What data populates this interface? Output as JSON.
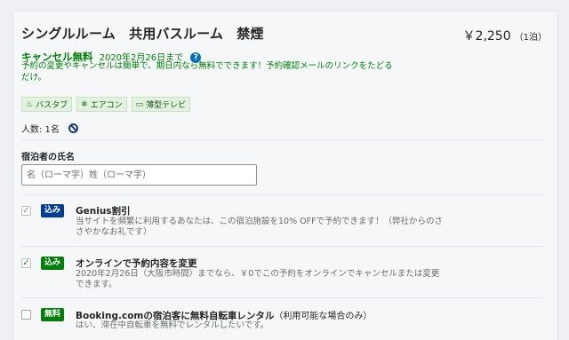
{
  "room": {
    "title": "シングルルーム　共用バスルーム　禁煙",
    "price": "￥2,250",
    "price_unit": "（1泊）"
  },
  "cancellation": {
    "headline": "キャンセル無料",
    "date": "2020年2月26日まで",
    "info_icon": "?",
    "description": "予約の変更やキャンセルは簡単で、期日内なら無料でできます！予約確認メールのリンクをたどるだけ。"
  },
  "facilities": [
    {
      "icon": "bath-icon",
      "glyph": "♨",
      "label": "バスタブ"
    },
    {
      "icon": "snowflake-icon",
      "glyph": "❄",
      "label": "エアコン"
    },
    {
      "icon": "tv-icon",
      "glyph": "▭",
      "label": "薄型テレビ"
    }
  ],
  "guests": {
    "label": "人数: 1名",
    "icon": "no-smoking-icon"
  },
  "guest_name": {
    "label": "宿泊者の氏名",
    "placeholder": "名（ローマ字）姓（ローマ字）",
    "value": ""
  },
  "options": [
    {
      "checked": true,
      "badge": "込み",
      "badge_color": "#003b95",
      "title": "Genius割引",
      "title_suffix": "",
      "description": "当サイトを頻繁に利用するあなたは、この宿泊施設を10% OFFで予約できます！（弊社からのささやかなお礼です）"
    },
    {
      "checked": true,
      "badge": "込み",
      "badge_color": "#008009",
      "title": "オンラインで予約内容を変更",
      "title_suffix": "",
      "description": "2020年2月26日（大阪市時間）までなら、￥0でこの予約をオンラインでキャンセルまたは変更できます。"
    },
    {
      "checked": false,
      "badge": "無料",
      "badge_color": "#008009",
      "title": "Booking.comの宿泊客に無料自転車レンタル",
      "title_suffix": "（利用可能な場合のみ）",
      "description": "はい、滞在中自転車を無料でレンタルしたいです。"
    }
  ],
  "colors": {
    "accent_green": "#008009",
    "genius_blue": "#003b95",
    "info_blue": "#0071c2"
  }
}
